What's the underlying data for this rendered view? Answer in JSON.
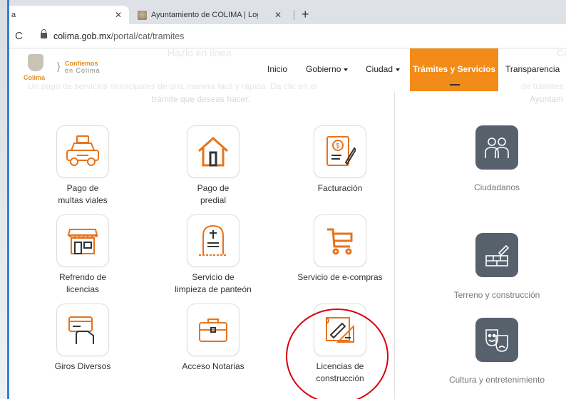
{
  "browser": {
    "tabs": [
      {
        "title": "a"
      },
      {
        "title": "Ayuntamiento de COLIMA | Login"
      }
    ],
    "new_tab_label": "+",
    "close_label": "✕",
    "reload_label": "C",
    "url_host": "colima.gob.mx",
    "url_path": "/portal/cat/tramites"
  },
  "site": {
    "logo_text": "Colima",
    "brand_title": "Confiemos",
    "brand_sub": "en Colima",
    "ghost_heading": "Hazlo en línea",
    "ghost_heading_right": "Ca",
    "nav": {
      "inicio": "Inicio",
      "gobierno": "Gobierno",
      "ciudad": "Ciudad",
      "tramites": "Trámites y Servicios",
      "transparencia": "Transparencia"
    },
    "ghost_intro": "Un pago de servicios municipales de una manera fácil y rápida. Da clic en el",
    "ghost_intro_right": "de trámites q",
    "ghost_line2": "trámite que deseas hacer.",
    "ghost_line2_right": "Ayuntam"
  },
  "services": [
    {
      "line1": "Pago de",
      "line2": "multas viales",
      "icon": "car-icon"
    },
    {
      "line1": "Pago de",
      "line2": "predial",
      "icon": "house-icon"
    },
    {
      "line1": "Facturación",
      "line2": "",
      "icon": "invoice-icon"
    },
    {
      "line1": "Refrendo de",
      "line2": "licencias",
      "icon": "store-icon"
    },
    {
      "line1": "Servicio de",
      "line2": "limpieza de panteón",
      "icon": "tombstone-icon"
    },
    {
      "line1": "Servicio de e-compras",
      "line2": "",
      "icon": "cart-icon"
    },
    {
      "line1": "Giros Diversos",
      "line2": "",
      "icon": "card-hand-icon"
    },
    {
      "line1": "Acceso Notarias",
      "line2": "",
      "icon": "briefcase-icon"
    },
    {
      "line1": "Licencias de",
      "line2": "construcción",
      "icon": "blueprint-icon"
    }
  ],
  "categories": [
    {
      "label": "Ciudadanos",
      "icon": "people-icon"
    },
    {
      "label": "Terreno y construcción",
      "icon": "bricks-icon"
    },
    {
      "label": "Cultura y entretenimiento",
      "icon": "theater-masks-icon"
    }
  ],
  "colors": {
    "accent": "#f28b18",
    "icon_orange": "#e8731a",
    "category_tile": "#56616c",
    "highlight": "#d9000d"
  }
}
